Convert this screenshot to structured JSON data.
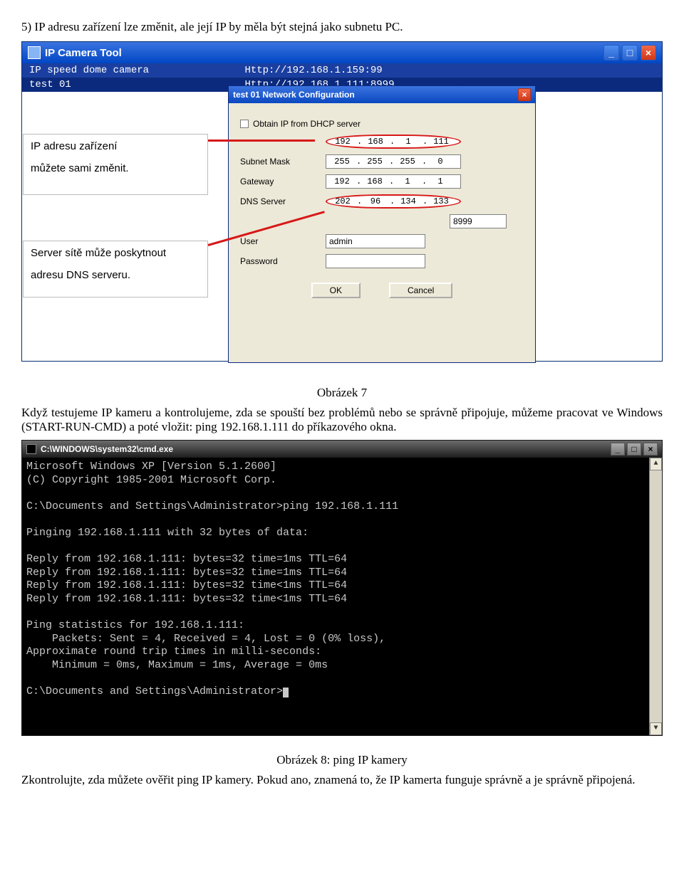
{
  "paragraphs": {
    "p1": "5) IP adresu zařízení lze změnit, ale její IP by měla být stejná jako subnetu PC.",
    "caption1": "Obrázek 7",
    "p2": "Když testujeme IP kameru a kontrolujeme, zda se spouští bez problémů nebo se správně připojuje, můžeme pracovat ve Windows (START-RUN-CMD) a poté vložit: ping 192.168.1.111 do příkazového okna.",
    "caption2": "Obrázek 8: ping IP kamery",
    "p3": "Zkontrolujte, zda můžete ověřit ping IP kamery. Pokud ano, znamená to, že IP kamerta funguje správně a je správně připojená."
  },
  "notes": {
    "n1a": "IP adresu zařízení",
    "n1b": "můžete sami změnit.",
    "n2a": "Server sítě může poskytnout",
    "n2b": "adresu DNS serveru."
  },
  "ipcam": {
    "app_title": "IP Camera Tool",
    "row1_name": "IP speed dome camera",
    "row1_url": "Http://192.168.1.159:99",
    "row2_name": "test 01",
    "row2_url": "Http://192.168.1.111:8999",
    "dialog_title": "test 01 Network Configuration",
    "dhcp_label": "Obtain IP from DHCP server",
    "labels": {
      "subnet": "Subnet Mask",
      "gateway": "Gateway",
      "dns": "DNS Server",
      "user": "User",
      "password": "Password"
    },
    "ip": {
      "a": "192",
      "b": "168",
      "c": "1",
      "d": "111"
    },
    "subnet": {
      "a": "255",
      "b": "255",
      "c": "255",
      "d": "0"
    },
    "gateway": {
      "a": "192",
      "b": "168",
      "c": "1",
      "d": "1"
    },
    "dns": {
      "a": "202",
      "b": "96",
      "c": "134",
      "d": "133"
    },
    "port": "8999",
    "user": "admin",
    "password": "",
    "ok": "OK",
    "cancel": "Cancel"
  },
  "cmd": {
    "title": "C:\\WINDOWS\\system32\\cmd.exe",
    "l1": "Microsoft Windows XP [Version 5.1.2600]",
    "l2": "(C) Copyright 1985-2001 Microsoft Corp.",
    "l3": "C:\\Documents and Settings\\Administrator>ping 192.168.1.111",
    "l4": "Pinging 192.168.1.111 with 32 bytes of data:",
    "l5": "Reply from 192.168.1.111: bytes=32 time=1ms TTL=64",
    "l6": "Reply from 192.168.1.111: bytes=32 time=1ms TTL=64",
    "l7": "Reply from 192.168.1.111: bytes=32 time<1ms TTL=64",
    "l8": "Reply from 192.168.1.111: bytes=32 time<1ms TTL=64",
    "l9": "Ping statistics for 192.168.1.111:",
    "l10": "    Packets: Sent = 4, Received = 4, Lost = 0 (0% loss),",
    "l11": "Approximate round trip times in milli-seconds:",
    "l12": "    Minimum = 0ms, Maximum = 1ms, Average = 0ms",
    "l13": "C:\\Documents and Settings\\Administrator>"
  }
}
